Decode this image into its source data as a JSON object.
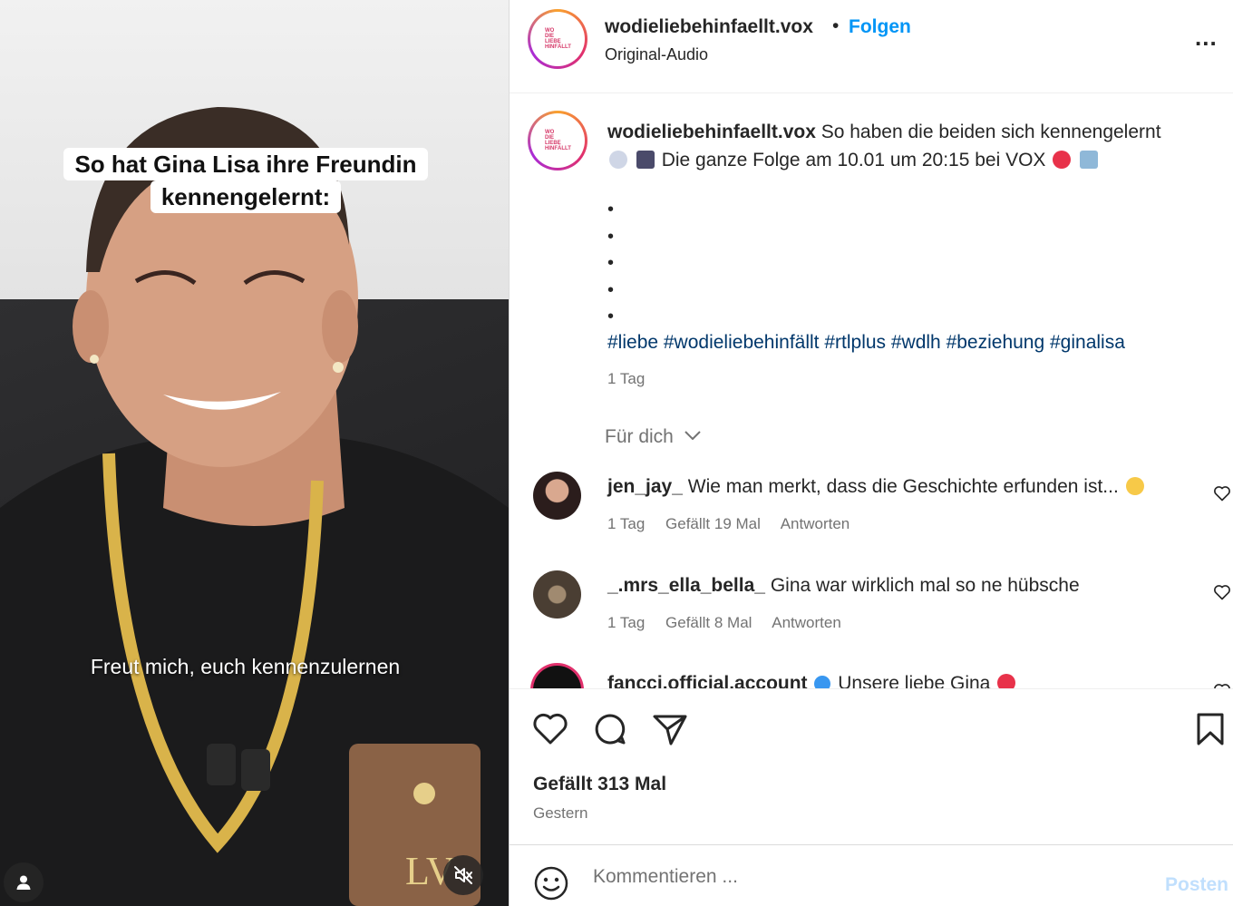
{
  "media": {
    "caption_overlay": "So hat Gina Lisa ihre Freundin kennengelernt:",
    "subtitle": "Freut mich, euch kennenzulernen",
    "user_icon": "user-icon",
    "mute_icon": "speaker-muted-icon"
  },
  "header": {
    "username": "wodieliebehinfaellt.vox",
    "separator": "•",
    "follow_label": "Folgen",
    "audio": "Original-Audio",
    "more_label": "..."
  },
  "caption": {
    "username": "wodieliebehinfaellt.vox",
    "line1": "So haben die beiden sich kennengelernt",
    "line2": "Die ganze Folge am 10.01 um 20:15 bei VOX",
    "bullets": [
      "•",
      "•",
      "•",
      "•",
      "•"
    ],
    "hashtags": "#liebe #wodieliebehinfällt #rtlplus #wdlh #beziehung #ginalisa",
    "time": "1 Tag"
  },
  "for_you": {
    "label": "Für dich"
  },
  "comments": [
    {
      "username": "jen_jay_",
      "text": "Wie man merkt, dass die Geschichte erfunden ist...",
      "time": "1 Tag",
      "likes": "Gefällt 19 Mal",
      "reply": "Antworten"
    },
    {
      "username": "_.mrs_ella_bella_",
      "text": "Gina war wirklich mal so ne hübsche",
      "time": "1 Tag",
      "likes": "Gefällt 8 Mal",
      "reply": "Antworten"
    },
    {
      "username": "fancci.official.account",
      "text": "Unsere liebe Gina"
    }
  ],
  "actions": {
    "likes": "Gefällt 313 Mal",
    "date": "Gestern"
  },
  "compose": {
    "placeholder": "Kommentieren ...",
    "post_label": "Posten"
  },
  "colors": {
    "accent": "#0095f6",
    "hashtag": "#00376b",
    "muted": "#737373",
    "post_disabled": "#c0dffd"
  }
}
